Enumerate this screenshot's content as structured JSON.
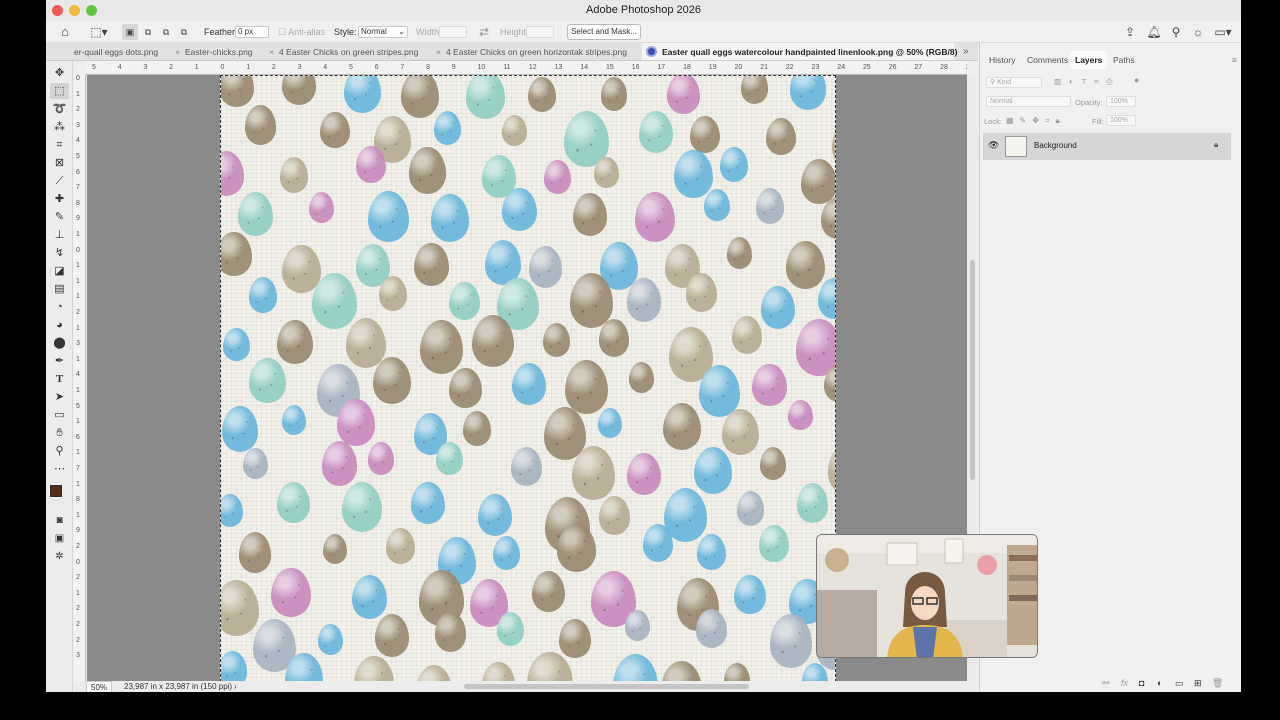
{
  "app": {
    "title": "Adobe Photoshop 2026"
  },
  "options_bar": {
    "feather_label": "Feather:",
    "feather_value": "0 px",
    "anti_alias_label": "Anti-alias",
    "style_label": "Style:",
    "style_value": "Normal",
    "width_label": "Width:",
    "height_label": "Height:",
    "select_mask_label": "Select and Mask..."
  },
  "tabs": [
    {
      "label": "er-quail eggs dots.png"
    },
    {
      "label": "Easter-chicks.png"
    },
    {
      "label": "4 Easter Chicks on green stripes.png"
    },
    {
      "label": "4 Easter Chicks on green horizontak stripes.png"
    },
    {
      "label": "Easter quail eggs watercolour handpainted linenlook.png @ 50% (RGB/8)"
    }
  ],
  "ruler_top_labels": [
    "5",
    "4",
    "3",
    "2",
    "1",
    "0",
    "1",
    "2",
    "3",
    "4",
    "5",
    "6",
    "7",
    "8",
    "9",
    "10",
    "11",
    "12",
    "13",
    "14",
    "15",
    "16",
    "17",
    "18",
    "19",
    "20",
    "21",
    "22",
    "23",
    "24",
    "25",
    "26",
    "27",
    "28",
    "2"
  ],
  "ruler_left_labels": [
    "0",
    "1",
    "2",
    "3",
    "4",
    "5",
    "6",
    "7",
    "8",
    "9",
    "1",
    "0",
    "1",
    "1",
    "1",
    "2",
    "1",
    "3",
    "1",
    "4",
    "1",
    "5",
    "1",
    "6",
    "1",
    "7",
    "1",
    "8",
    "1",
    "9",
    "2",
    "0",
    "2",
    "1",
    "2",
    "2",
    "2",
    "3"
  ],
  "status": {
    "zoom": "50%",
    "doc_info": "23,987 in x 23,987 in (150 ppi)",
    "arrow": "›"
  },
  "panel": {
    "tabs": [
      "History",
      "Comments",
      "Layers",
      "Paths"
    ],
    "active_tab": "Layers",
    "kind_label": "Kind",
    "blend_mode": "Normal",
    "opacity_label": "Opacity:",
    "opacity_value": "100%",
    "lock_label": "Lock:",
    "fill_label": "Fill:",
    "fill_value": "100%",
    "layer_name": "Background"
  },
  "colors": {
    "foreground": "#5a2a1c",
    "background": "#ffffff",
    "canvas_bg": "#8a8a8a",
    "paper": "#f1f0ea",
    "egg_blue": "#6bb7dc",
    "egg_brown": "#9a8a70",
    "egg_pink": "#c98bbf",
    "egg_teal": "#93cfc4",
    "egg_grey": "#a8b4c2",
    "egg_tan": "#b8ac93"
  },
  "icons": {
    "home": "home-icon",
    "marquee": "rectangular-marquee-icon",
    "share": "share-icon",
    "bell": "bell-icon",
    "search": "search-icon",
    "light": "lightbulb-icon",
    "workspace": "workspace-icon",
    "eye": "eye-icon",
    "lock": "lock-icon"
  }
}
